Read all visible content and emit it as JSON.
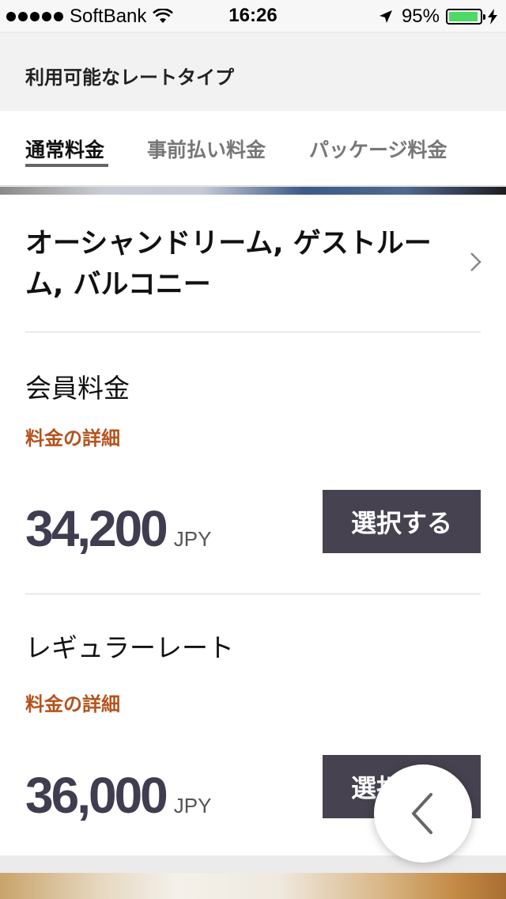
{
  "status_bar": {
    "carrier": "SoftBank",
    "time": "16:26",
    "battery_percent": "95%",
    "battery_level": 0.95,
    "icons": [
      "signal-dots-icon",
      "wifi-icon",
      "location-arrow-icon",
      "battery-icon",
      "charging-bolt-icon"
    ]
  },
  "header": {
    "title": "利用可能なレートタイプ"
  },
  "tabs": [
    {
      "label": "通常料金",
      "active": true
    },
    {
      "label": "事前払い料金",
      "active": false
    },
    {
      "label": "パッケージ料金",
      "active": false
    }
  ],
  "room": {
    "title": "オーシャンドリーム, ゲストルーム, バルコニー",
    "rates": [
      {
        "name": "会員料金",
        "detail_link": "料金の詳細",
        "price": "34,200",
        "currency": "JPY",
        "button": "選択する"
      },
      {
        "name": "レギュラーレート",
        "detail_link": "料金の詳細",
        "price": "36,000",
        "currency": "JPY",
        "button": "選択する"
      }
    ]
  },
  "colors": {
    "accent": "#b5531d",
    "button": "#46424f",
    "battery": "#4cd964"
  }
}
